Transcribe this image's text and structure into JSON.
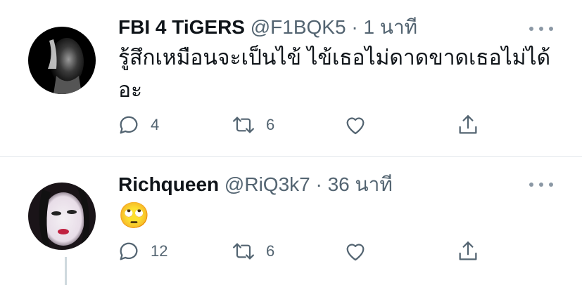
{
  "tweets": [
    {
      "name": "FBI 4 TiGERS",
      "handle": "@F1BQK5",
      "separator": "·",
      "time": "1 นาที",
      "text": "รู้สึกเหมือนจะเป็นไข้ ไข้เธอไม่ดาดขาดเธอไม่ได้อะ",
      "reply_count": "4",
      "retweet_count": "6",
      "like_count": "",
      "icons": {
        "reply": "reply-icon",
        "retweet": "retweet-icon",
        "like": "heart-icon",
        "share": "share-icon",
        "more": "more-icon"
      }
    },
    {
      "name": "Richqueen",
      "handle": "@RiQ3k7",
      "separator": "·",
      "time": "36 นาที",
      "text": "🙄",
      "reply_count": "12",
      "retweet_count": "6",
      "like_count": "",
      "icons": {
        "reply": "reply-icon",
        "retweet": "retweet-icon",
        "like": "heart-icon",
        "share": "share-icon",
        "more": "more-icon"
      }
    }
  ],
  "colors": {
    "text_primary": "#0f1419",
    "text_secondary": "#536471",
    "icon": "#536471",
    "divider": "#e1e6ea"
  }
}
